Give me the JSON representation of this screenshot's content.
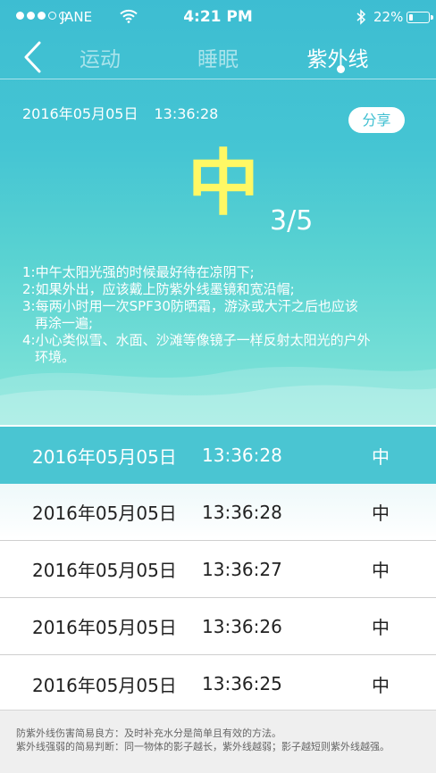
{
  "status_bar": {
    "carrier": "JANE",
    "time": "4:21 PM",
    "battery": "22%"
  },
  "nav": {
    "tabs": [
      {
        "label": "运动"
      },
      {
        "label": "睡眠"
      },
      {
        "label": "紫外线"
      }
    ],
    "active_tab": "紫外线"
  },
  "reading": {
    "date": "2016年05月05日",
    "time": "13:36:28",
    "level": "中",
    "score": "3/5",
    "share_label": "分享"
  },
  "tips": [
    "1:中午太阳光强的时候最好待在凉阴下;",
    "2:如果外出，应该戴上防紫外线墨镜和宽沿帽;",
    "3:每两小时用一次SPF30防晒霜，游泳或大汗之后也应该",
    "再涂一遍;",
    "4:小心类似雪、水面、沙滩等像镜子一样反射太阳光的户外",
    "环境。"
  ],
  "history": [
    {
      "date": "2016年05月05日",
      "time": "13:36:28",
      "level": "中"
    },
    {
      "date": "2016年05月05日",
      "time": "13:36:28",
      "level": "中"
    },
    {
      "date": "2016年05月05日",
      "time": "13:36:27",
      "level": "中"
    },
    {
      "date": "2016年05月05日",
      "time": "13:36:26",
      "level": "中"
    },
    {
      "date": "2016年05月05日",
      "time": "13:36:25",
      "level": "中"
    }
  ],
  "footer": {
    "line1": "防紫外线伤害简易良方：及时补充水分是简单且有效的方法。",
    "line2": "紫外线强弱的简易判断：同一物体的影子越长，紫外线越弱；影子越短则紫外线越强。"
  },
  "colors": {
    "accent": "#3fbfd1",
    "level": "#fff864"
  }
}
